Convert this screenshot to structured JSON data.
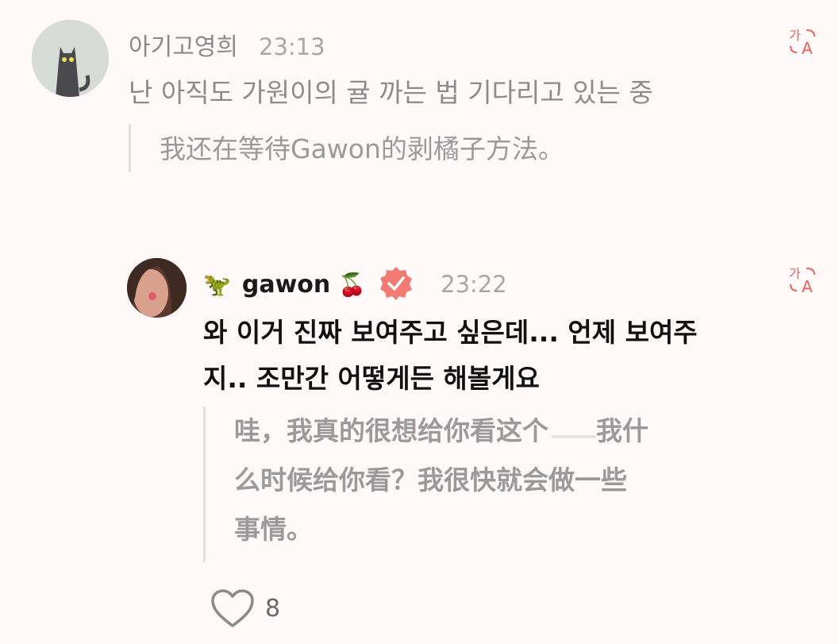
{
  "comment1": {
    "username": "아기고영희",
    "time": "23:13",
    "text": "난 아직도 가원이의 귤 까는 법 기다리고 있는 중",
    "translation": "我还在等待Gawon的剥橘子方法。"
  },
  "reply1": {
    "emoji_left": "🦖",
    "username": "gawon",
    "emoji_right": "🍒",
    "time": "23:22",
    "text_line1": "와 이거 진짜 보여주고 싶은데... 언제 보여주",
    "text_line2": "지.. 조만간 어떻게든 해볼게요",
    "translation_line1": "哇，我真的很想给你看这个",
    "translation_line1_end": "我什",
    "translation_line2": "么时候给你看？我很快就会做一些",
    "translation_line3": "事情。",
    "likes": "8"
  },
  "icons": {
    "translate": "translate-icon",
    "verified": "verified-badge-icon",
    "like": "heart-icon"
  },
  "colors": {
    "background": "#fff9fa",
    "accent": "#f0605a",
    "verified": "#f27b73"
  }
}
